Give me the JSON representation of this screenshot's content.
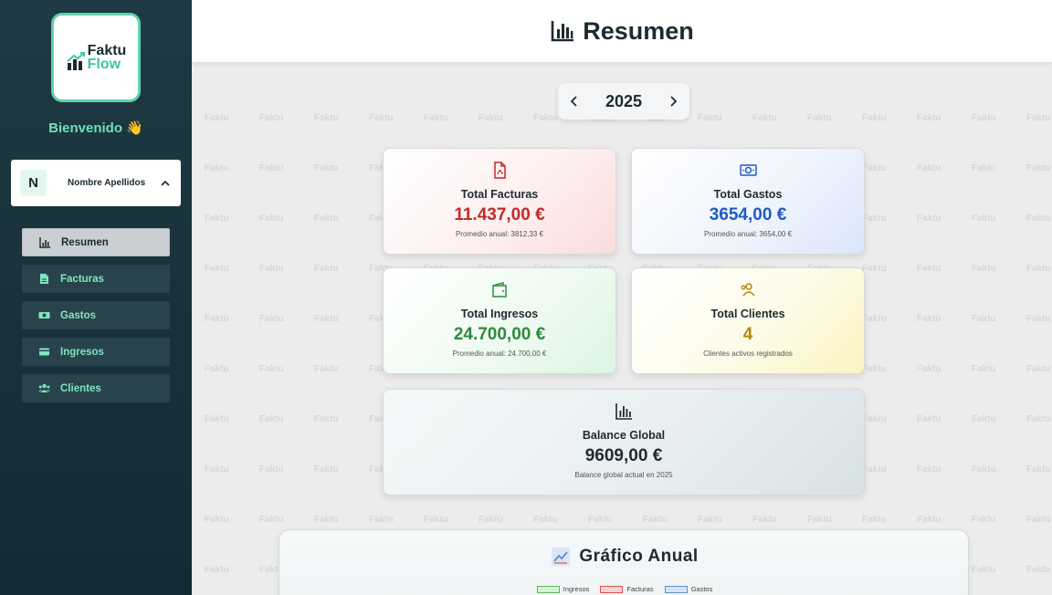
{
  "sidebar": {
    "logo": {
      "line1": "Faktu",
      "line2": "Flow"
    },
    "welcome": "Bienvenido 👋",
    "user": {
      "initial": "N",
      "name": "Nombre Apellidos"
    },
    "nav": [
      {
        "label": "Resumen",
        "icon": "chart-bar-icon",
        "active": true
      },
      {
        "label": "Facturas",
        "icon": "file-invoice-icon",
        "active": false
      },
      {
        "label": "Gastos",
        "icon": "money-bill-icon",
        "active": false
      },
      {
        "label": "Ingresos",
        "icon": "wallet-icon",
        "active": false
      },
      {
        "label": "Clientes",
        "icon": "users-icon",
        "active": false
      }
    ]
  },
  "header": {
    "title": "Resumen",
    "icon": "chart-bar-icon"
  },
  "year_selector": {
    "year": "2025"
  },
  "cards": {
    "facturas": {
      "title": "Total Facturas",
      "value": "11.437,00 €",
      "sub": "Promedio anual: 3812,33 €",
      "color": "#c62828"
    },
    "gastos": {
      "title": "Total Gastos",
      "value": "3654,00 €",
      "sub": "Promedio anual: 3654,00 €",
      "color": "#1e5bc6"
    },
    "ingresos": {
      "title": "Total Ingresos",
      "value": "24.700,00 €",
      "sub": "Promedio anual: 24.700,00 €",
      "color": "#2e8b3e"
    },
    "clientes": {
      "title": "Total Clientes",
      "value": "4",
      "sub": "Clientes activos registrados",
      "color": "#b8860b"
    },
    "balance": {
      "title": "Balance Global",
      "value": "9609,00 €",
      "sub": "Balance global actual en 2025",
      "color": "#1d2b31"
    }
  },
  "chart": {
    "title": "Gráfico Anual",
    "legend": [
      {
        "label": "Ingresos",
        "color": "#5cb85c"
      },
      {
        "label": "Facturas",
        "color": "#d9534f"
      },
      {
        "label": "Gastos",
        "color": "#5b8fd9"
      }
    ]
  },
  "colors": {
    "accent": "#5fd3ad",
    "sidebar_bg": "#1e3a44"
  }
}
